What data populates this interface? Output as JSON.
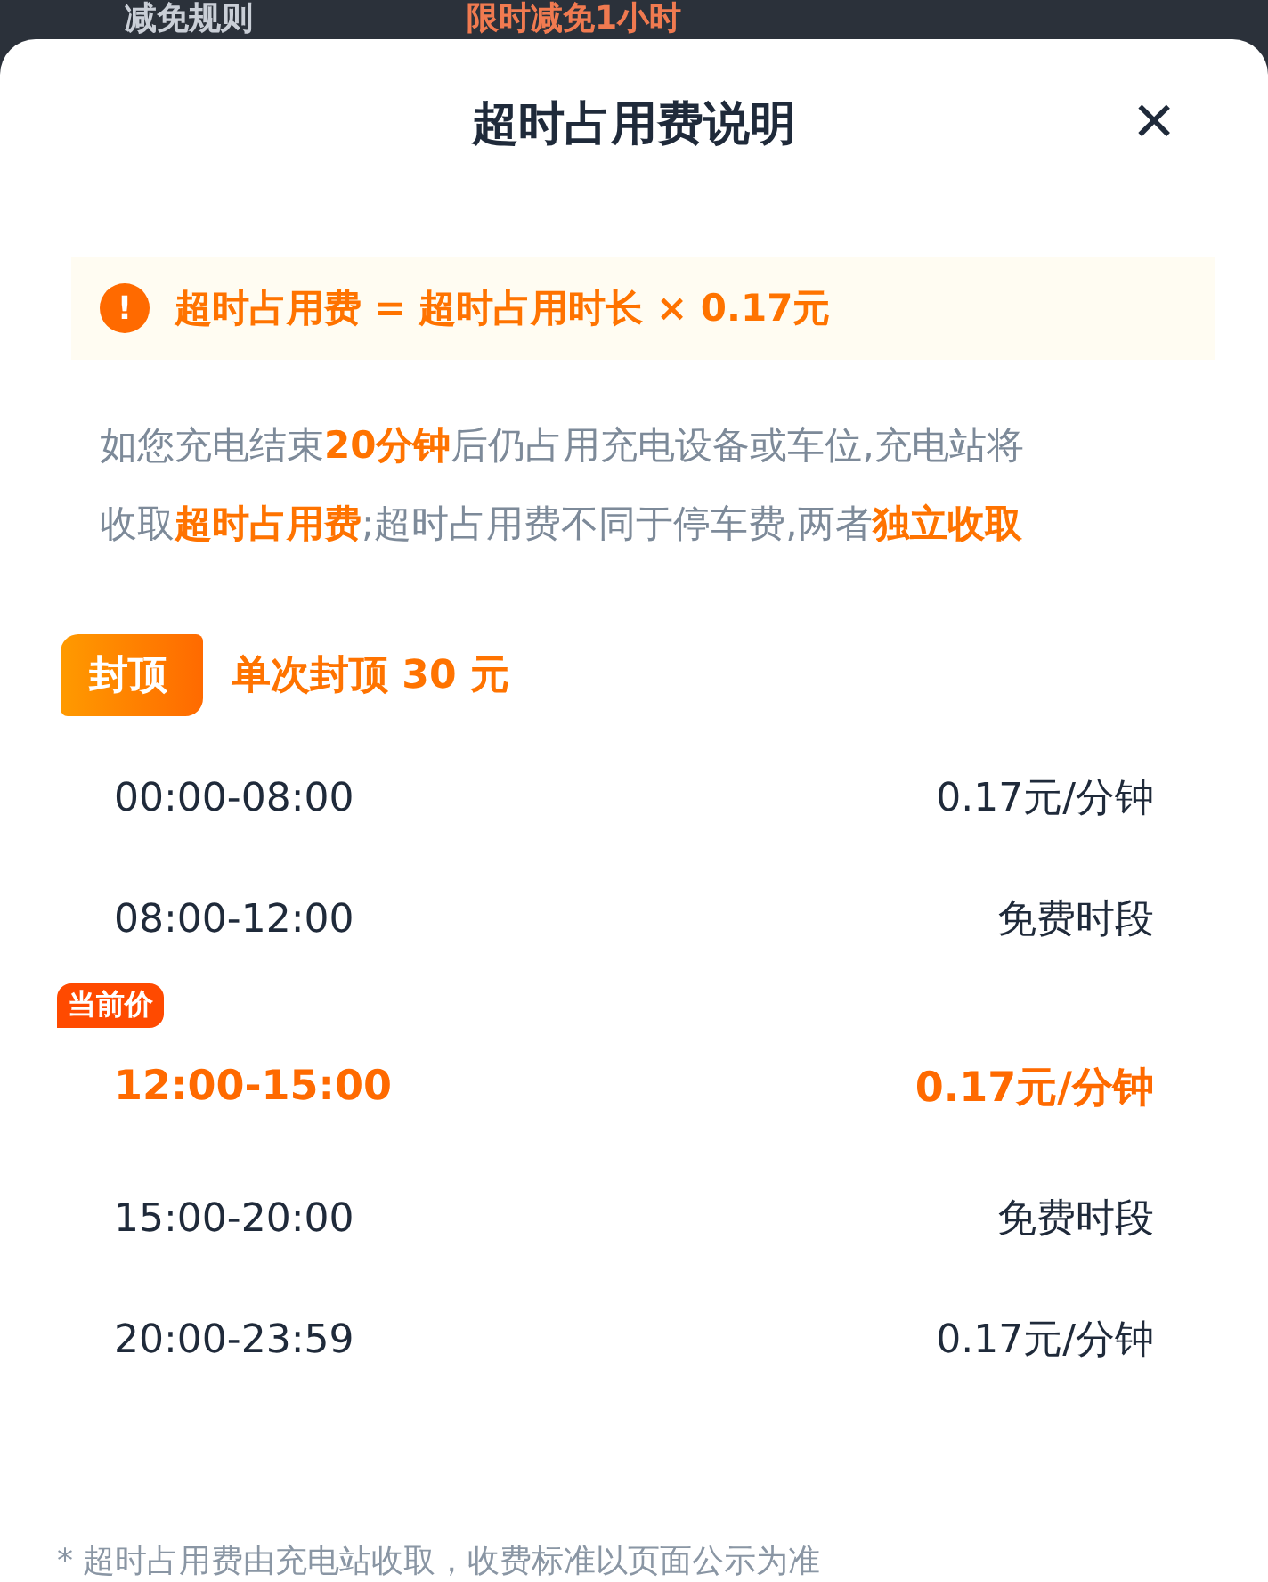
{
  "background_page": {
    "label": "减免规则",
    "value": "限时减免1小时"
  },
  "sheet": {
    "title": "超时占用费说明",
    "close": "×"
  },
  "formula": {
    "icon": "!",
    "text": "超时占用费 = 超时占用时长 × 0.17元"
  },
  "description": "如您充电结束**20分钟**后仍占用充电设备或车位,充电站将收取**超时占用费**;超时占用费不同于停车费,两者**独立收取**",
  "cap": {
    "badge": "封顶",
    "text": "单次封顶 30 元"
  },
  "periods": [
    {
      "time": "00:00-08:00",
      "price": "0.17元/分钟",
      "current": false
    },
    {
      "time": "08:00-12:00",
      "price": "免费时段",
      "current": false
    },
    {
      "time": "12:00-15:00",
      "price": "0.17元/分钟",
      "current": true,
      "tag": "当前价"
    },
    {
      "time": "15:00-20:00",
      "price": "免费时段",
      "current": false
    },
    {
      "time": "20:00-23:59",
      "price": "0.17元/分钟",
      "current": false
    }
  ],
  "footnote": "* 超时占用费由充电站收取，收费标准以页面公示为准"
}
